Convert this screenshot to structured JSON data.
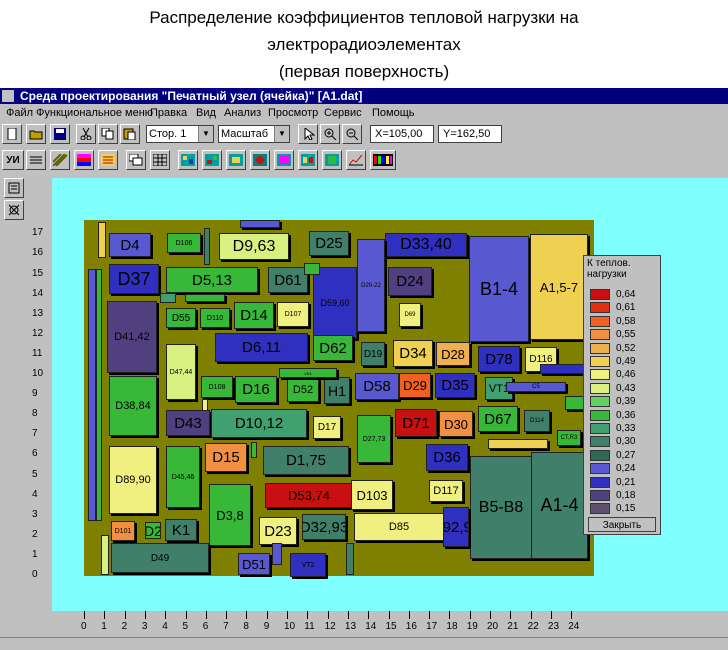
{
  "caption": {
    "line1": "Распределение коэффициентов тепловой нагрузки на",
    "line2": "электрорадиоэлементах",
    "line3": "(первая поверхность)"
  },
  "window": {
    "title": "Среда проектирования \"Печатный узел (ячейка)\"    [A1.dat]"
  },
  "menu": [
    "Файл",
    "Функциональное меню",
    "Правка",
    "Вид",
    "Анализ",
    "Просмотр",
    "Сервис",
    "Помощь"
  ],
  "toolbar": {
    "page_select": "Стор. 1",
    "scale_select": "Масштаб",
    "x_coord": "X=105,00",
    "y_coord": "Y=162,50",
    "button_label": "УИ"
  },
  "ruler": {
    "y_ticks": [
      "0",
      "1",
      "2",
      "3",
      "4",
      "5",
      "6",
      "7",
      "8",
      "9",
      "10",
      "11",
      "12",
      "13",
      "14",
      "15",
      "16",
      "17"
    ],
    "x_ticks": [
      "0",
      "1",
      "2",
      "3",
      "4",
      "5",
      "6",
      "7",
      "8",
      "9",
      "10",
      "11",
      "12",
      "13",
      "14",
      "15",
      "16",
      "17",
      "18",
      "19",
      "20",
      "21",
      "22",
      "23",
      "24"
    ]
  },
  "legend": {
    "title": "К теплов. нагрузки",
    "values": [
      "0,64",
      "0,61",
      "0,58",
      "0,55",
      "0,52",
      "0,49",
      "0,46",
      "0,43",
      "0,39",
      "0,36",
      "0,33",
      "0,30",
      "0,27",
      "0,24",
      "0,21",
      "0,18",
      "0,15"
    ],
    "colors": [
      "#c81010",
      "#e03010",
      "#f06020",
      "#f09040",
      "#f0b050",
      "#f0d050",
      "#f0f080",
      "#d8f080",
      "#60d060",
      "#38b838",
      "#40a070",
      "#40806a",
      "#306858",
      "#5858d0",
      "#3030c0",
      "#504080",
      "#605070"
    ],
    "close_label": "Закрыть"
  },
  "components": [
    {
      "label": "D4",
      "color": "#5858d0",
      "fs": 15
    },
    {
      "label": "D106",
      "color": "#38b838",
      "fs": 7
    },
    {
      "label": "D9,63",
      "color": "#d8f080",
      "fs": 16
    },
    {
      "label": "D25",
      "color": "#40806a",
      "fs": 15
    },
    {
      "label": "D33,40",
      "color": "#3030c0",
      "fs": 16
    },
    {
      "label": "B1-4",
      "color": "#5858d0",
      "fs": 18
    },
    {
      "label": "A1,5-7",
      "color": "#f0d050",
      "fs": 13
    },
    {
      "label": "D37",
      "color": "#3030c0",
      "fs": 18
    },
    {
      "label": "D5,13",
      "color": "#38b838",
      "fs": 15
    },
    {
      "label": "D61",
      "color": "#40806a",
      "fs": 15
    },
    {
      "label": "D59,60",
      "color": "#3030c0",
      "fs": 9
    },
    {
      "label": "D20-22",
      "color": "#5858d0",
      "fs": 6
    },
    {
      "label": "D24",
      "color": "#504080",
      "fs": 15
    },
    {
      "label": "D41,42",
      "color": "#504080",
      "fs": 11
    },
    {
      "label": "D55",
      "color": "#38b838",
      "fs": 10
    },
    {
      "label": "D110",
      "color": "#38b838",
      "fs": 7
    },
    {
      "label": "D14",
      "color": "#38b838",
      "fs": 15
    },
    {
      "label": "D107",
      "color": "#f0f080",
      "fs": 7
    },
    {
      "label": "D69",
      "color": "#f0f080",
      "fs": 6
    },
    {
      "label": "D47,44",
      "color": "#d8f080",
      "fs": 7
    },
    {
      "label": "D6,11",
      "color": "#3030c0",
      "fs": 15
    },
    {
      "label": "D62",
      "color": "#38b838",
      "fs": 15
    },
    {
      "label": "D19",
      "color": "#40806a",
      "fs": 10
    },
    {
      "label": "D34",
      "color": "#f0d050",
      "fs": 15
    },
    {
      "label": "D28",
      "color": "#f0b050",
      "fs": 13
    },
    {
      "label": "D78",
      "color": "#3030c0",
      "fs": 15
    },
    {
      "label": "D116",
      "color": "#f0f080",
      "fs": 10
    },
    {
      "label": "D38,84",
      "color": "#38b838",
      "fs": 11
    },
    {
      "label": "D108",
      "color": "#38b838",
      "fs": 7
    },
    {
      "label": "D16",
      "color": "#38b838",
      "fs": 15
    },
    {
      "label": "D52",
      "color": "#38b838",
      "fs": 11
    },
    {
      "label": "H1",
      "color": "#40806a",
      "fs": 14
    },
    {
      "label": "D58",
      "color": "#5858d0",
      "fs": 15
    },
    {
      "label": "D29",
      "color": "#f06020",
      "fs": 13
    },
    {
      "label": "D35",
      "color": "#3030c0",
      "fs": 15
    },
    {
      "label": "VT1",
      "color": "#40a070",
      "fs": 11
    },
    {
      "label": "D43",
      "color": "#504080",
      "fs": 15
    },
    {
      "label": "D10,12",
      "color": "#40a070",
      "fs": 15
    },
    {
      "label": "D17",
      "color": "#f0f080",
      "fs": 10
    },
    {
      "label": "D27,73",
      "color": "#38b838",
      "fs": 7
    },
    {
      "label": "D71",
      "color": "#c81010",
      "fs": 15
    },
    {
      "label": "D30",
      "color": "#f09040",
      "fs": 13
    },
    {
      "label": "D67",
      "color": "#38b838",
      "fs": 15
    },
    {
      "label": "D114",
      "color": "#40806a",
      "fs": 6
    },
    {
      "label": "D15",
      "color": "#f09040",
      "fs": 15
    },
    {
      "label": "D1,75",
      "color": "#40806a",
      "fs": 15
    },
    {
      "label": "D36",
      "color": "#3030c0",
      "fs": 15
    },
    {
      "label": "D89,90",
      "color": "#f0f080",
      "fs": 11
    },
    {
      "label": "D45,46",
      "color": "#38b838",
      "fs": 7
    },
    {
      "label": "D3,8",
      "color": "#38b838",
      "fs": 13
    },
    {
      "label": "D53,74",
      "color": "#c81010",
      "fs": 13
    },
    {
      "label": "D103",
      "color": "#f0f080",
      "fs": 13
    },
    {
      "label": "D117",
      "color": "#f0f080",
      "fs": 11
    },
    {
      "label": "B5-B8",
      "color": "#40806a",
      "fs": 16
    },
    {
      "label": "A1-4",
      "color": "#40806a",
      "fs": 18
    },
    {
      "label": "D101",
      "color": "#f09040",
      "fs": 7
    },
    {
      "label": "D2",
      "color": "#38b838",
      "fs": 14
    },
    {
      "label": "K1",
      "color": "#40806a",
      "fs": 15
    },
    {
      "label": "D23",
      "color": "#f0f080",
      "fs": 15
    },
    {
      "label": "D32,93",
      "color": "#40806a",
      "fs": 15
    },
    {
      "label": "D85",
      "color": "#f0f080",
      "fs": 11
    },
    {
      "label": "D92,94",
      "color": "#3030c0",
      "fs": 15
    },
    {
      "label": "D49",
      "color": "#40806a",
      "fs": 10
    },
    {
      "label": "D51",
      "color": "#5858d0",
      "fs": 13
    },
    {
      "label": "VT2",
      "color": "#3030c0",
      "fs": 7
    },
    {
      "label": "CT,R3",
      "color": "#38b838",
      "fs": 6
    },
    {
      "label": "VD1",
      "color": "#38b838",
      "fs": 4
    },
    {
      "label": "C5",
      "color": "#5858d0",
      "fs": 6
    },
    {
      "label": "",
      "color": "#40a070",
      "fs": 6
    },
    {
      "label": "",
      "color": "#f0d050",
      "fs": 6
    },
    {
      "label": "",
      "color": "#5858d0",
      "fs": 6
    },
    {
      "label": "",
      "color": "#38b838",
      "fs": 6
    },
    {
      "label": "",
      "color": "#d8f080",
      "fs": 6
    },
    {
      "label": "",
      "color": "#40806a",
      "fs": 6
    },
    {
      "label": "",
      "color": "#5858d0",
      "fs": 6
    },
    {
      "label": "",
      "color": "#38b838",
      "fs": 6
    },
    {
      "label": "",
      "color": "#f0f080",
      "fs": 6
    },
    {
      "label": "",
      "color": "#38b838",
      "fs": 6
    },
    {
      "label": "",
      "color": "#5858d0",
      "fs": 6
    },
    {
      "label": "",
      "color": "#f0d050",
      "fs": 6
    },
    {
      "label": "",
      "color": "#38b838",
      "fs": 6
    },
    {
      "label": "",
      "color": "#3030c0",
      "fs": 6
    },
    {
      "label": "",
      "color": "#38b838",
      "fs": 6
    },
    {
      "label": "",
      "color": "#40806a",
      "fs": 6
    }
  ]
}
